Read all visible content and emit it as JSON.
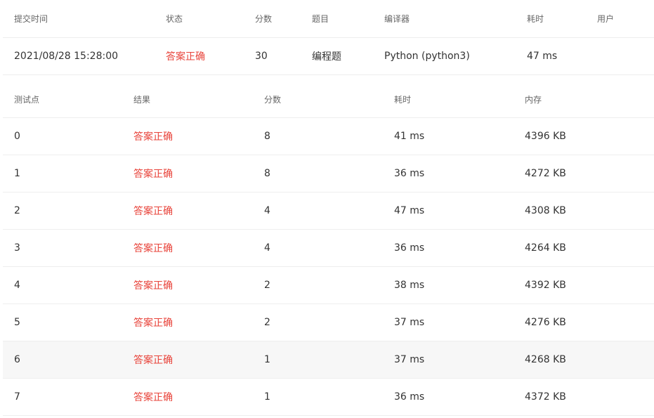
{
  "submission": {
    "headers": {
      "time": "提交时间",
      "status": "状态",
      "score": "分数",
      "problem": "题目",
      "compiler": "编译器",
      "duration": "耗时",
      "user": "用户"
    },
    "row": {
      "time": "2021/08/28 15:28:00",
      "status": "答案正确",
      "score": "30",
      "problem": "编程题",
      "compiler": "Python (python3)",
      "duration": "47 ms",
      "user": ""
    }
  },
  "cases": {
    "headers": {
      "case": "测试点",
      "result": "结果",
      "score": "分数",
      "duration": "耗时",
      "memory": "内存"
    },
    "rows": [
      {
        "case": "0",
        "result": "答案正确",
        "score": "8",
        "duration": "41 ms",
        "memory": "4396 KB"
      },
      {
        "case": "1",
        "result": "答案正确",
        "score": "8",
        "duration": "36 ms",
        "memory": "4272 KB"
      },
      {
        "case": "2",
        "result": "答案正确",
        "score": "4",
        "duration": "47 ms",
        "memory": "4308 KB"
      },
      {
        "case": "3",
        "result": "答案正确",
        "score": "4",
        "duration": "36 ms",
        "memory": "4264 KB"
      },
      {
        "case": "4",
        "result": "答案正确",
        "score": "2",
        "duration": "38 ms",
        "memory": "4392 KB"
      },
      {
        "case": "5",
        "result": "答案正确",
        "score": "2",
        "duration": "37 ms",
        "memory": "4276 KB"
      },
      {
        "case": "6",
        "result": "答案正确",
        "score": "1",
        "duration": "37 ms",
        "memory": "4268 KB"
      },
      {
        "case": "7",
        "result": "答案正确",
        "score": "1",
        "duration": "36 ms",
        "memory": "4372 KB"
      }
    ]
  },
  "colors": {
    "accepted": "#e8433a",
    "row_highlight": "#f7f7f7",
    "divider": "#eeeeee"
  }
}
